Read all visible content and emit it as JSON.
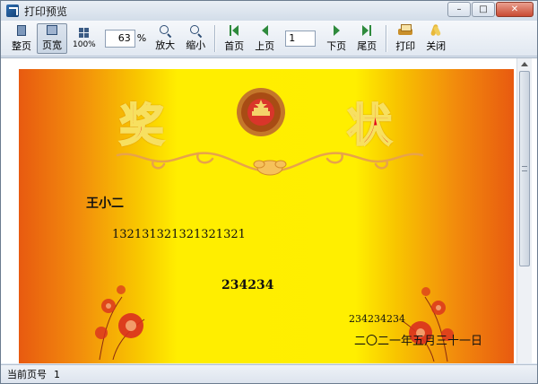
{
  "window": {
    "title": "打印预览",
    "controls": {
      "minimize": "–",
      "maximize": "□",
      "close": "✕"
    }
  },
  "toolbar": {
    "whole_page": "整页",
    "page_width": "页宽",
    "actual_size": "100%",
    "zoom_value": "63",
    "zoom_unit": "%",
    "zoom_in": "放大",
    "zoom_out": "缩小",
    "first_page": "首页",
    "prev_page": "上页",
    "page_number": "1",
    "next_page": "下页",
    "last_page": "尾页",
    "print": "打印",
    "close": "关闭"
  },
  "certificate": {
    "title_left": "奖",
    "title_right": "状",
    "name": "王小二",
    "id_number": "132131321321321321",
    "award": "234234",
    "code": "234234234",
    "date": "二〇二一年五月三十一日",
    "colors": {
      "edge": "#e85a10",
      "center": "#ffee00",
      "title": "#e3001b"
    }
  },
  "status": {
    "current_page_label": "当前页号",
    "current_page_value": "1"
  }
}
